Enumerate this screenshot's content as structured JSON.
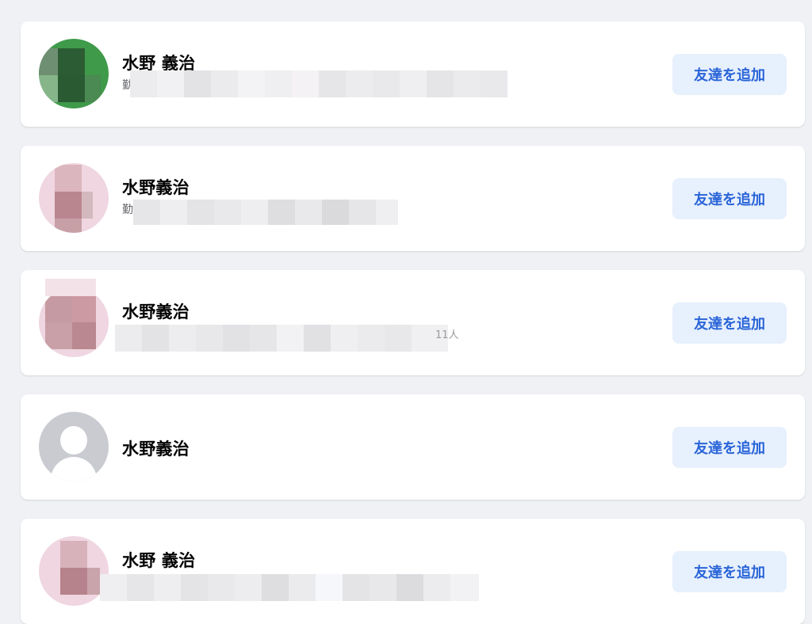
{
  "colors": {
    "page_background": "#eff1f5",
    "card_background": "#ffffff",
    "button_background": "#e7f0fd",
    "button_text": "#2a65d8",
    "name_text": "#050505"
  },
  "suggestions": [
    {
      "name": "水野 義治",
      "subtitle_prefix": "勤",
      "avatar": "photo-green",
      "action_label": "友達を追加"
    },
    {
      "name": "水野義治",
      "subtitle_prefix": "勤",
      "avatar": "photo-pink",
      "action_label": "友達を追加"
    },
    {
      "name": "水野義治",
      "subtitle_suffix": "11人",
      "avatar": "photo-pink",
      "action_label": "友達を追加"
    },
    {
      "name": "水野義治",
      "avatar": "default-person-icon",
      "action_label": "友達を追加"
    },
    {
      "name": "水野 義治",
      "avatar": "photo-pink",
      "action_label": "友達を追加"
    }
  ]
}
